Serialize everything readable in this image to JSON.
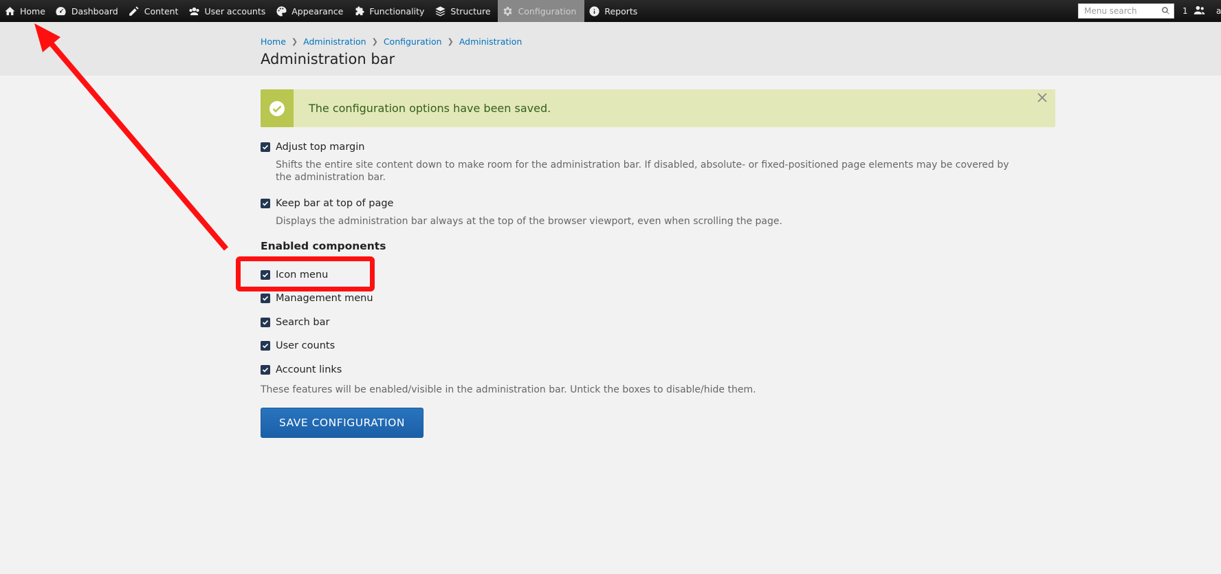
{
  "adminbar": {
    "items": [
      {
        "label": "Home",
        "icon": "home-icon"
      },
      {
        "label": "Dashboard",
        "icon": "dashboard-icon"
      },
      {
        "label": "Content",
        "icon": "pencil-icon"
      },
      {
        "label": "User accounts",
        "icon": "users-icon"
      },
      {
        "label": "Appearance",
        "icon": "palette-icon"
      },
      {
        "label": "Functionality",
        "icon": "puzzle-icon"
      },
      {
        "label": "Structure",
        "icon": "layers-icon"
      },
      {
        "label": "Configuration",
        "icon": "gear-icon",
        "active": true
      },
      {
        "label": "Reports",
        "icon": "info-icon"
      }
    ],
    "search_placeholder": "Menu search",
    "user_count": "1",
    "account_label": "a"
  },
  "breadcrumb": [
    "Home",
    "Administration",
    "Configuration",
    "Administration"
  ],
  "page_title": "Administration bar",
  "message": "The configuration options have been saved.",
  "form": {
    "adjust_top_margin": {
      "label": "Adjust top margin",
      "checked": true,
      "description": "Shifts the entire site content down to make room for the administration bar. If disabled, absolute- or fixed-positioned page elements may be covered by the administration bar."
    },
    "keep_bar_top": {
      "label": "Keep bar at top of page",
      "checked": true,
      "description": "Displays the administration bar always at the top of the browser viewport, even when scrolling the page."
    },
    "components_heading": "Enabled components",
    "components": [
      {
        "label": "Icon menu",
        "checked": true
      },
      {
        "label": "Management menu",
        "checked": true
      },
      {
        "label": "Search bar",
        "checked": true
      },
      {
        "label": "User counts",
        "checked": true
      },
      {
        "label": "Account links",
        "checked": true
      }
    ],
    "components_description": "These features will be enabled/visible in the administration bar. Untick the boxes to disable/hide them.",
    "save_label": "SAVE CONFIGURATION"
  },
  "colors": {
    "accent": "#1f69b2",
    "annotation": "#ff1010",
    "message_bg": "#e3e8b8"
  }
}
